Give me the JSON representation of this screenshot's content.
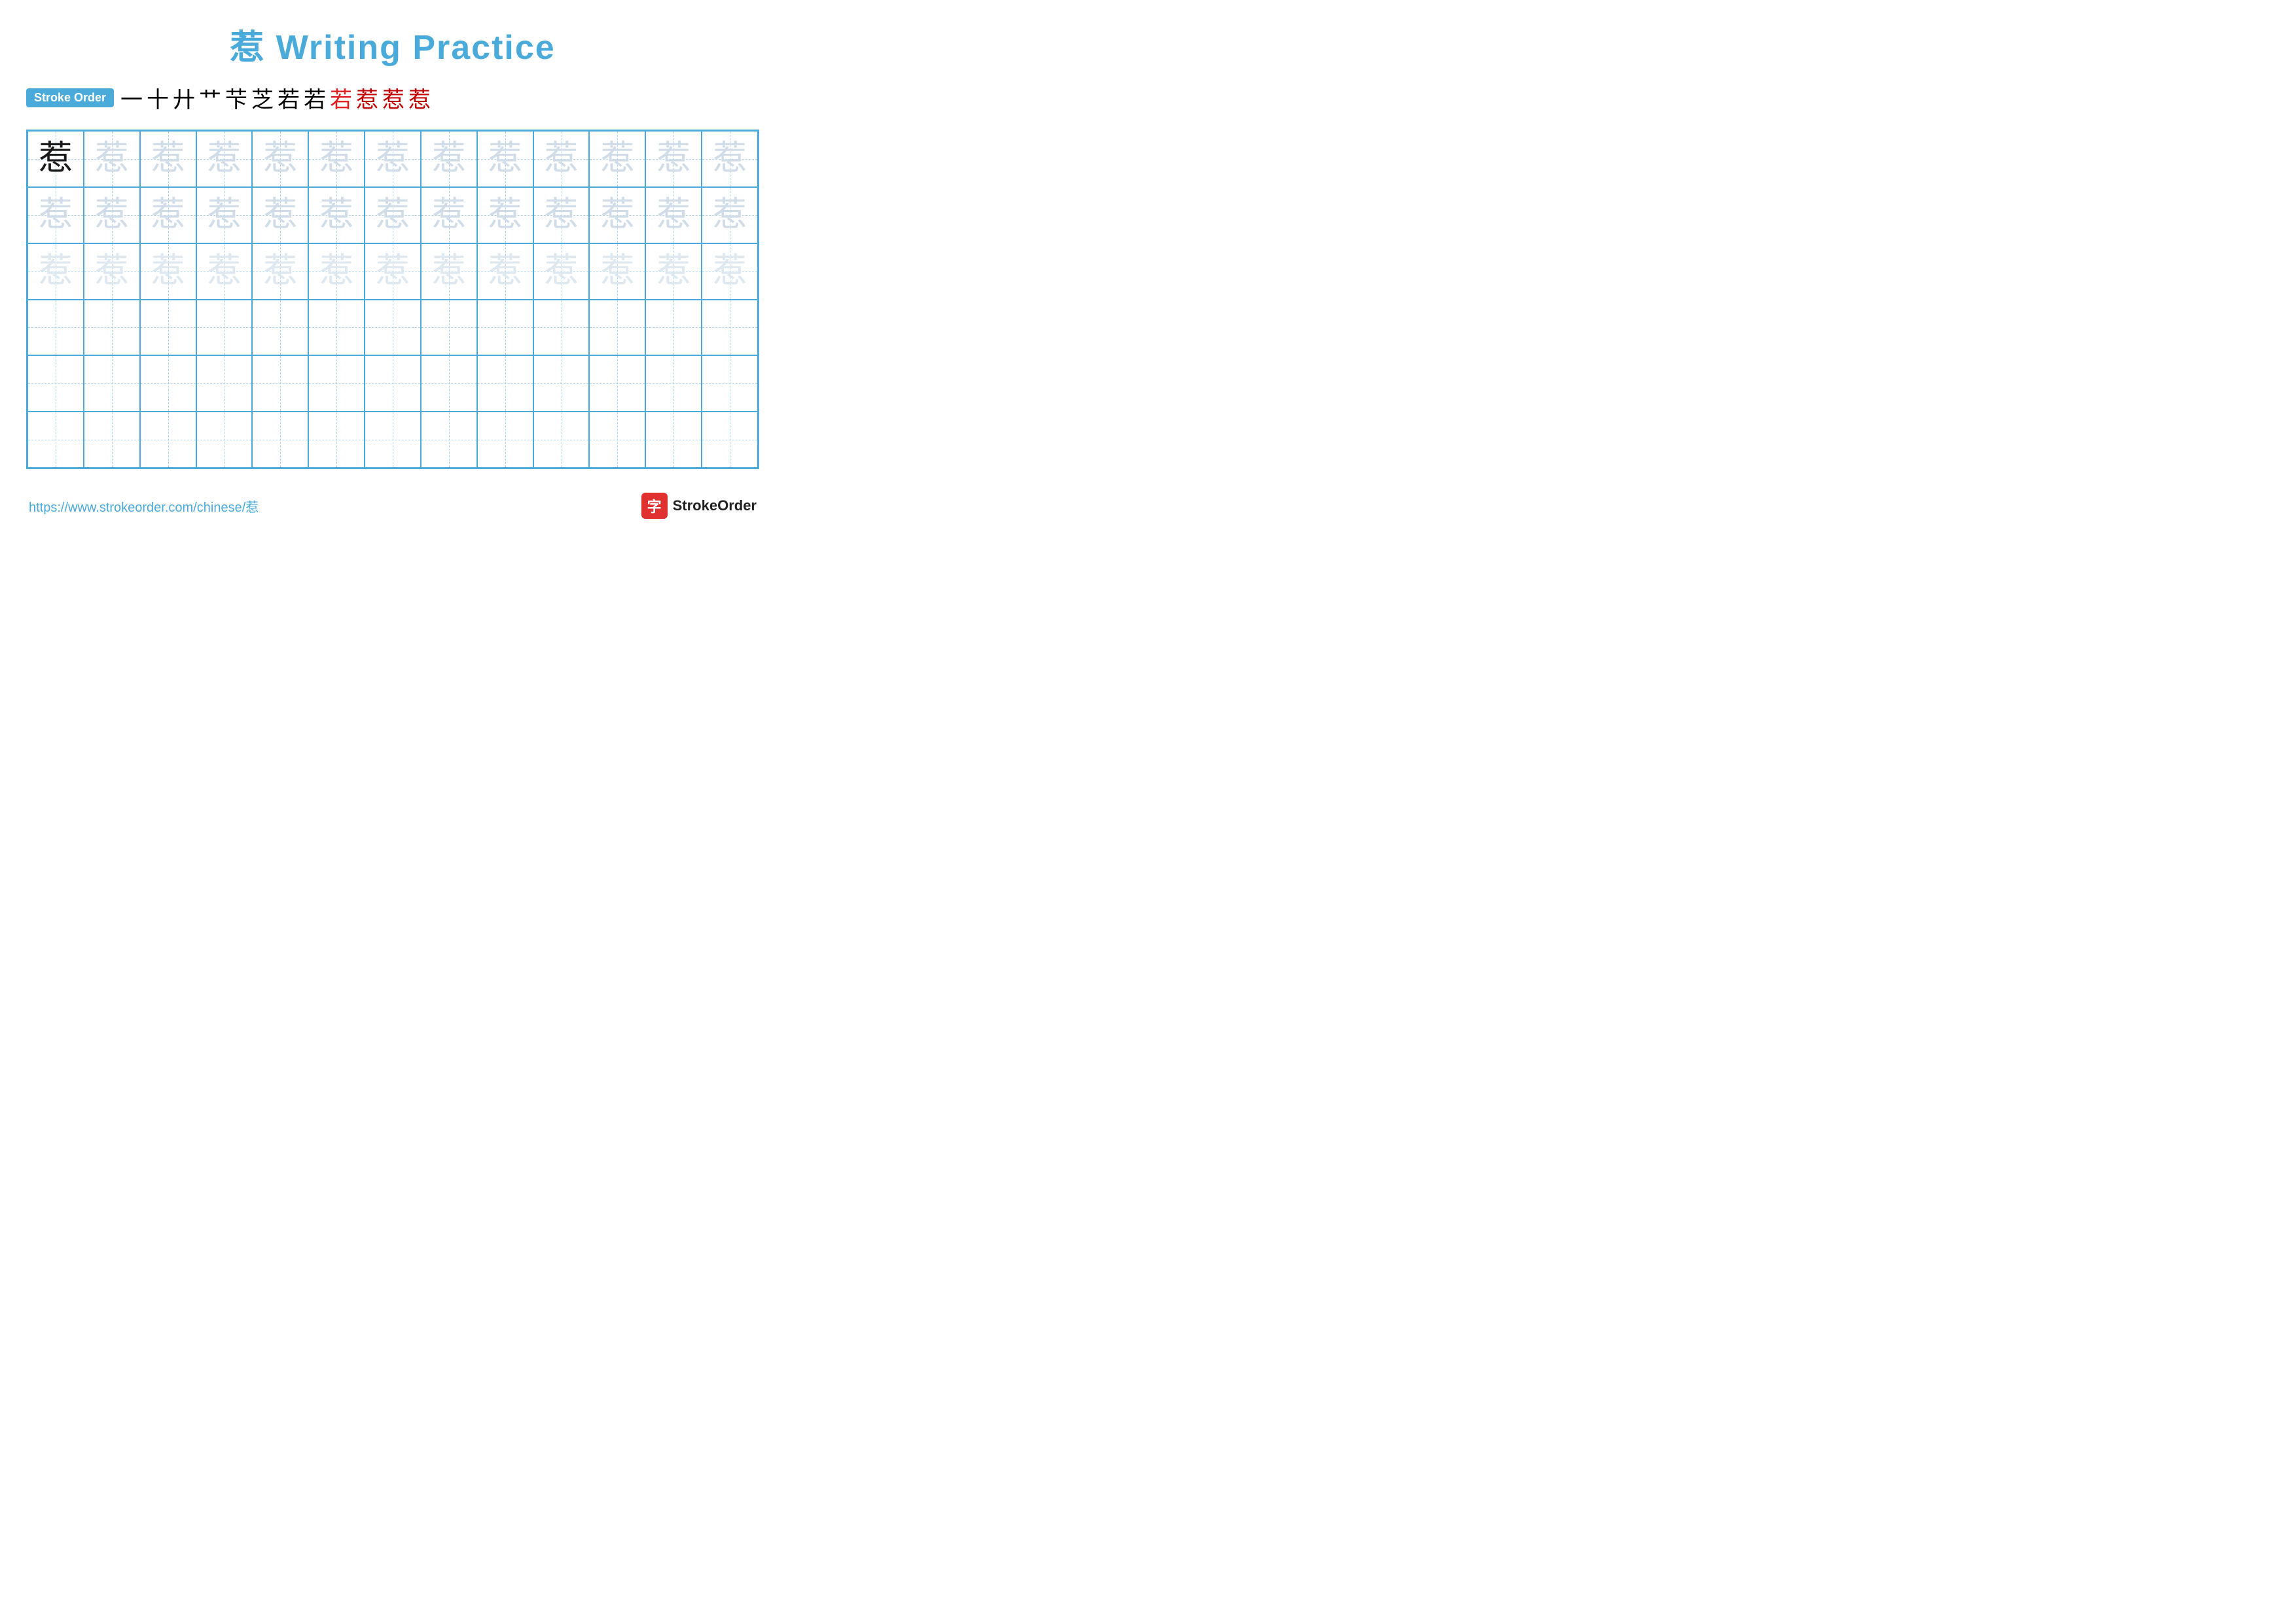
{
  "title": {
    "char": "惹",
    "rest": " Writing Practice"
  },
  "strokeOrder": {
    "badge": "Stroke Order",
    "chars": [
      "一",
      "十",
      "廾",
      "艹",
      "芐",
      "芝",
      "若",
      "若",
      "若",
      "惹",
      "惹",
      "惹"
    ]
  },
  "grid": {
    "rows": 6,
    "cols": 13,
    "char": "惹",
    "row1_style": "black_then_light",
    "row2_style": "light",
    "row3_style": "lighter",
    "rows4to6_style": "empty"
  },
  "footer": {
    "url": "https://www.strokeorder.com/chinese/惹",
    "brand": "StrokeOrder",
    "brand_char": "字"
  }
}
